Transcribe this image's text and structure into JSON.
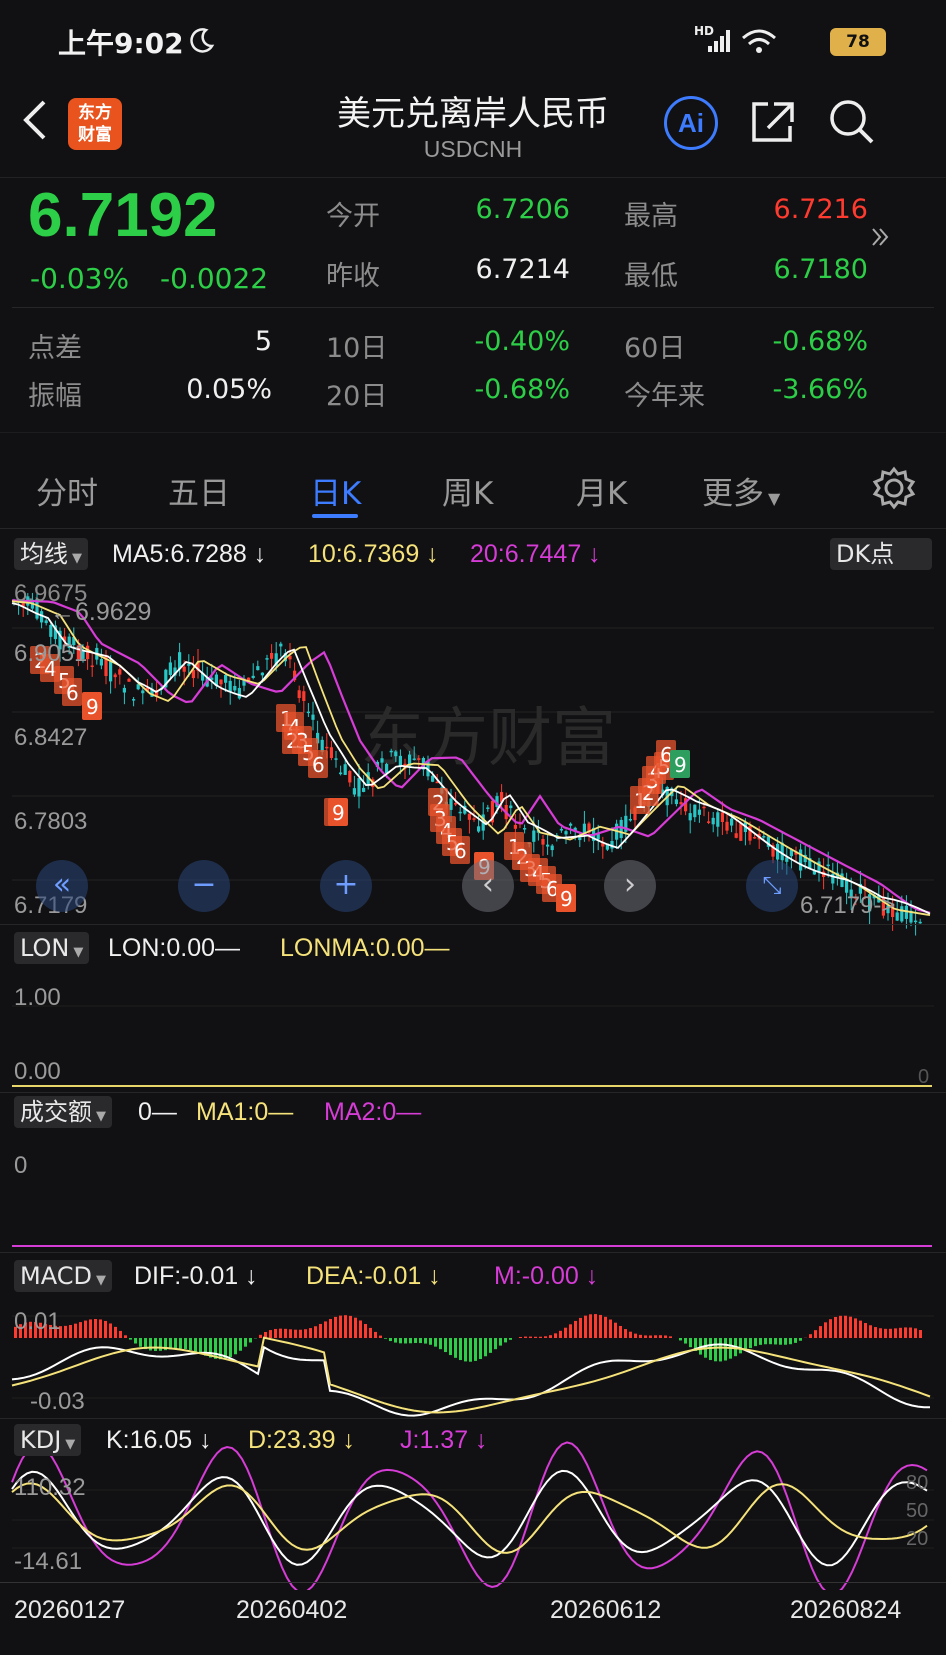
{
  "status": {
    "time": "上午9:02",
    "battery": "78",
    "net": "HD"
  },
  "header": {
    "title": "美元兑离岸人民币",
    "symbol": "USDCNH",
    "logo": "东方\n财富",
    "ai": "Ai"
  },
  "quote": {
    "price": "6.7192",
    "change_pct": "-0.03%",
    "change": "-0.0022",
    "open_label": "今开",
    "open": "6.7206",
    "high_label": "最高",
    "high": "6.7216",
    "prev_label": "昨收",
    "prev": "6.7214",
    "low_label": "最低",
    "low": "6.7180",
    "spread_label": "点差",
    "spread": "5",
    "d10_label": "10日",
    "d10": "-0.40%",
    "d60_label": "60日",
    "d60": "-0.68%",
    "amp_label": "振幅",
    "amp": "0.05%",
    "d20_label": "20日",
    "d20": "-0.68%",
    "ytd_label": "今年来",
    "ytd": "-3.66%"
  },
  "tabs": [
    "分时",
    "五日",
    "日K",
    "周K",
    "月K",
    "更多"
  ],
  "active_tab": "日K",
  "ma": {
    "select": "均线",
    "ma5": "MA5:6.7288 ↓",
    "ma10": "10:6.7369 ↓",
    "ma20": "20:6.7447 ↓",
    "dk": "DK点"
  },
  "price_axis": {
    "top": "6.9675",
    "l2": "6.9051",
    "l3": "6.8427",
    "l4": "6.7803",
    "bottom": "6.7179",
    "max_mark": "6.9629",
    "last_mark": "6.7179->"
  },
  "watermark": "东方财富",
  "lon": {
    "select": "LON",
    "lon": "LON:0.00—",
    "lonma": "LONMA:0.00—",
    "top": "1.00",
    "bottom": "0.00",
    "right": "0"
  },
  "volume": {
    "select": "成交额",
    "v": "0—",
    "ma1": "MA1:0—",
    "ma2": "MA2:0—",
    "axis": "0"
  },
  "macd": {
    "select": "MACD",
    "dif": "DIF:-0.01 ↓",
    "dea": "DEA:-0.01 ↓",
    "m": "M:-0.00 ↓",
    "top": "0.01",
    "bottom": "-0.03"
  },
  "kdj": {
    "select": "KDJ",
    "k": "K:16.05 ↓",
    "d": "D:23.39 ↓",
    "j": "J:1.37 ↓",
    "top": "110.32",
    "bottom": "-14.61",
    "r80": "80",
    "r50": "50",
    "r20": "20"
  },
  "dates": [
    "20260127",
    "20260402",
    "20260612",
    "20260824"
  ],
  "td_labels": [
    "2",
    "4",
    "5",
    "6",
    "9",
    "1",
    "4",
    "2",
    "3",
    "5",
    "6",
    "7",
    "9",
    "2",
    "3",
    "4",
    "5",
    "6",
    "9",
    "1",
    "2",
    "3",
    "4",
    "5",
    "6",
    "9",
    "1",
    "2",
    "3",
    "4",
    "5",
    "6",
    "9"
  ],
  "colors": {
    "up": "#ff3b30",
    "down": "#2ccf47",
    "candle_down": "#28c7c7",
    "ma5": "#ffffff",
    "ma10": "#f5e27a",
    "ma20": "#d63cd6",
    "accent": "#3d7bff"
  }
}
